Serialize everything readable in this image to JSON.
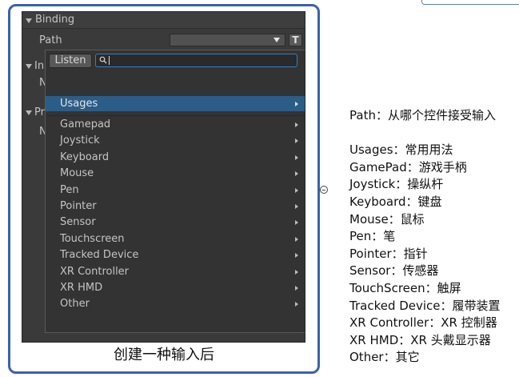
{
  "unity_panel": {
    "binding_header": {
      "label": "Binding"
    },
    "path_row": {
      "label": "Path",
      "dropdown_value": "",
      "t_button_label": "T"
    },
    "background_rows": {
      "interactions_header": "In",
      "interactions_note": "N",
      "processors_header": "Pr",
      "processors_note": "N"
    },
    "popup": {
      "listen_label": "Listen",
      "search_value": "",
      "selected_item": "Usages",
      "items": [
        "Gamepad",
        "Joystick",
        "Keyboard",
        "Mouse",
        "Pen",
        "Pointer",
        "Sensor",
        "Touchscreen",
        "Tracked Device",
        "XR Controller",
        "XR HMD",
        "Other"
      ]
    }
  },
  "caption": "创建一种输入后",
  "notes": [
    "Path：从哪个控件接受输入",
    "Usages：常用用法",
    "GamePad：游戏手柄",
    "Joystick：操纵杆",
    "Keyboard：键盘",
    "Mouse：鼠标",
    "Pen：笔",
    "Pointer：指针",
    "Sensor：传感器",
    "TouchScreen：触屏",
    "Tracked Device：履带装置",
    "XR Controller：XR 控制器",
    "XR HMD：XR 头戴显示器",
    "Other：其它"
  ],
  "icons": {
    "foldout": "triangle-down-icon",
    "dropdown": "dropdown-arrow-icon",
    "search": "search-icon",
    "submenu": "chevron-right-icon",
    "handle": "circle-minus-icon"
  },
  "colors": {
    "frame_border": "#3b62ad",
    "panel_background": "#3a3a3a",
    "selection": "#2c5d87",
    "search_focus": "#3a7bbf"
  }
}
